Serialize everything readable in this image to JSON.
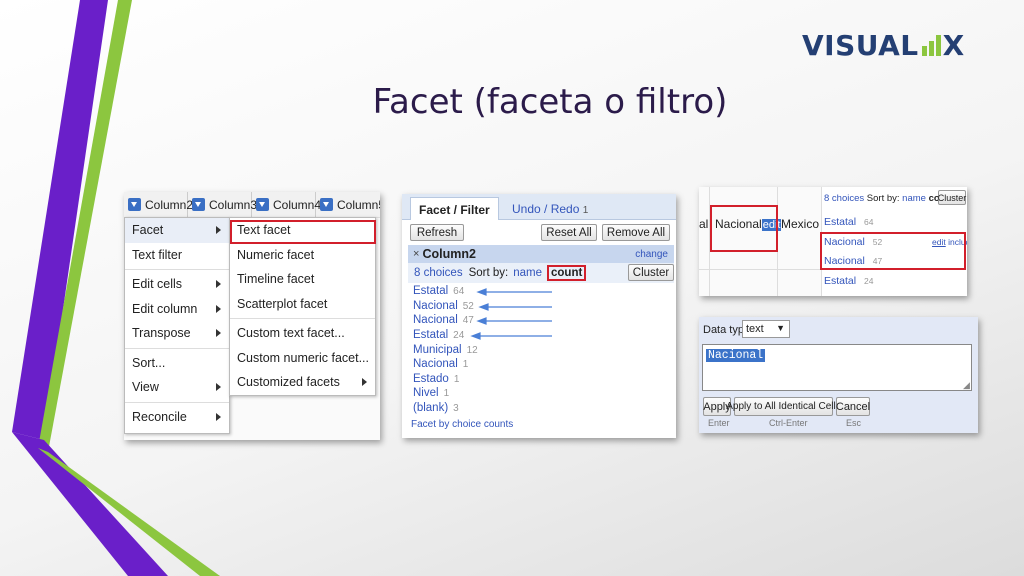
{
  "slide": {
    "title": "Facet (faceta o filtro)",
    "logo": {
      "text_left": "VISUAL",
      "text_right": "X"
    },
    "colors": {
      "purple": "#6a1fc9",
      "green": "#8cc63f",
      "title": "#2b1b4a",
      "logo": "#243f73",
      "highlight_box": "#d21f2b"
    }
  },
  "menu_screenshot": {
    "columns": [
      "Column2",
      "Column3",
      "Column4",
      "Column5"
    ],
    "menu_items": [
      {
        "label": "Facet",
        "submenu": true
      },
      {
        "label": "Text filter",
        "submenu": false
      },
      {
        "label": "Edit cells",
        "submenu": true
      },
      {
        "label": "Edit column",
        "submenu": true
      },
      {
        "label": "Transpose",
        "submenu": true
      },
      {
        "label": "Sort...",
        "submenu": false
      },
      {
        "label": "View",
        "submenu": true
      },
      {
        "label": "Reconcile",
        "submenu": true
      }
    ],
    "submenu_items": [
      {
        "label": "Text facet"
      },
      {
        "label": "Numeric facet"
      },
      {
        "label": "Timeline facet"
      },
      {
        "label": "Scatterplot facet"
      },
      {
        "label": "Custom text facet..."
      },
      {
        "label": "Custom numeric facet..."
      },
      {
        "label": "Customized facets",
        "submenu": true
      }
    ]
  },
  "facet_panel": {
    "tabs": [
      "Facet / Filter",
      "Undo / Redo"
    ],
    "undo_count": "1",
    "buttons": {
      "refresh": "Refresh",
      "reset_all": "Reset All",
      "remove_all": "Remove All"
    },
    "facet_title": "Column2",
    "close_glyph": "×",
    "change_link": "change",
    "choices_count": "8 choices",
    "sort_by_label": "Sort by:",
    "sort_name": "name",
    "sort_count": "count",
    "cluster_button": "Cluster",
    "choices": [
      {
        "name": "Estatal",
        "count": "64"
      },
      {
        "name": "Nacional",
        "count": "52"
      },
      {
        "name": "Nacional",
        "count": "47"
      },
      {
        "name": "Estatal",
        "count": "24"
      },
      {
        "name": "Municipal",
        "count": "12"
      },
      {
        "name": "Nacional",
        "count": "1"
      },
      {
        "name": "Estado",
        "count": "1"
      },
      {
        "name": "Nivel",
        "count": "1"
      },
      {
        "name": "(blank)",
        "count": "3"
      }
    ],
    "footer_link": "Facet by choice counts"
  },
  "cell_screenshot": {
    "left_fragment": "al",
    "cell_value": "Nacional",
    "edit_link": "edit",
    "next_value": "Mexico",
    "choices_count": "8 choices",
    "sort_by_label": "Sort by:",
    "sort_name": "name",
    "sort_count": "count",
    "cluster_button": "Cluster",
    "choices": [
      {
        "name": "Estatal",
        "count": "64"
      },
      {
        "name": "Nacional",
        "count": "52"
      },
      {
        "name": "Nacional",
        "count": "47"
      },
      {
        "name": "Estatal",
        "count": "24"
      }
    ],
    "row_actions": {
      "edit": "edit",
      "include": "include"
    }
  },
  "edit_dialog": {
    "data_type_label": "Data type:",
    "data_type_value": "text",
    "text_value": "Nacional",
    "buttons": {
      "apply": "Apply",
      "apply_all": "Apply to All Identical Cells",
      "cancel": "Cancel"
    },
    "hints": {
      "apply": "Enter",
      "apply_all": "Ctrl-Enter",
      "cancel": "Esc"
    }
  }
}
